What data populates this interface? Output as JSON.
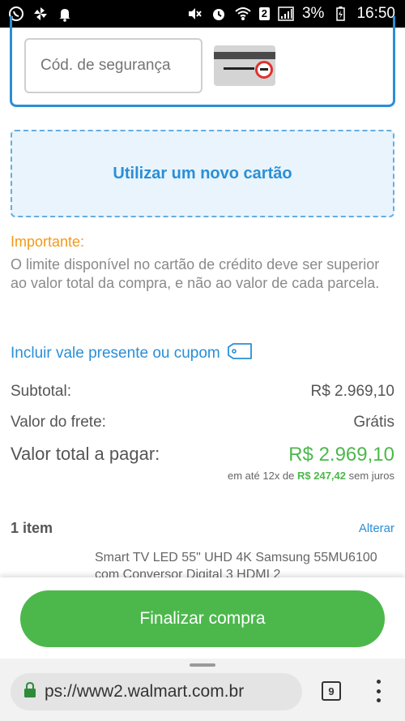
{
  "status_bar": {
    "left_icons": [
      "whatsapp-icon",
      "pinwheel-icon",
      "notification-bell-icon"
    ],
    "right_icons": [
      "mute-icon",
      "alarm-icon",
      "wifi-icon",
      "signal-icon",
      "battery-icon"
    ],
    "wifi_badge": "2",
    "battery_percent": "3%",
    "time": "16:50"
  },
  "payment": {
    "security_code_placeholder": "Cód. de segurança",
    "new_card_label": "Utilizar um novo cartão"
  },
  "important": {
    "title": "Importante:",
    "text": "O limite disponível no cartão de crédito deve ser superior ao valor total da compra, e não ao valor de cada parcela."
  },
  "coupon": {
    "label": "Incluir vale presente ou cupom"
  },
  "summary": {
    "subtotal_label": "Subtotal:",
    "subtotal_value": "R$ 2.969,10",
    "shipping_label": "Valor do frete:",
    "shipping_value": "Grátis",
    "total_label": "Valor total a pagar:",
    "total_value": "R$ 2.969,10",
    "installments_prefix": "em até 12x de",
    "installments_value": "R$ 247,42",
    "installments_suffix": "sem juros"
  },
  "items": {
    "count_label": "1 item",
    "edit_label": "Alterar",
    "product_name": "Smart TV LED 55\" UHD 4K Samsung 55MU6100 com Conversor Digital 3 HDMI 2"
  },
  "checkout": {
    "button_label": "Finalizar compra"
  },
  "browser": {
    "url_prefix": "ps://",
    "url_domain": "www2.walmart.com.br",
    "tab_count": "9"
  },
  "colors": {
    "accent_blue": "#2a8fd6",
    "green": "#4cb84c",
    "warning_orange": "#f39a17"
  }
}
